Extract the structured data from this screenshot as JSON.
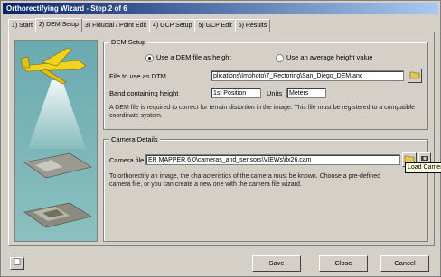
{
  "window": {
    "title": "Orthorectifying Wizard - Step 2 of 6"
  },
  "tabs": [
    "1) Start",
    "2) DEM Setup",
    "3) Fiducial / Point Edit",
    "4) GCP Setup",
    "5) GCP Edit",
    "6) Results"
  ],
  "dem_setup": {
    "group_label": "DEM Setup",
    "radio_dem": "Use a DEM file as height",
    "radio_average": "Use an average height value",
    "file_label": "File to use as DTM",
    "file_value": "plications\\Imphoto\\7_Rectoring\\San_Diego_DEM.anc",
    "geoid_label": "Band containing height",
    "geoid_value": "1st Position",
    "units_label": "Units",
    "units_value": "Meters",
    "description": "A DEM file is required to correct for terrain distortion in the image. This file must be registered to a compatible coordinate system."
  },
  "camera": {
    "group_label": "Camera Details",
    "file_label": "Camera file",
    "file_value": "ER MAPPER 6.0\\cameras_and_sensors\\VIEWs\\ilx26.cam",
    "tooltip": "Load Camera File",
    "description": "To orthorectify an image, the characteristics of the camera must be known. Choose a pre-defined camera file, or you can create a new one with the camera file wizard."
  },
  "footer": {
    "save": "Save",
    "close": "Close",
    "cancel": "Cancel"
  }
}
